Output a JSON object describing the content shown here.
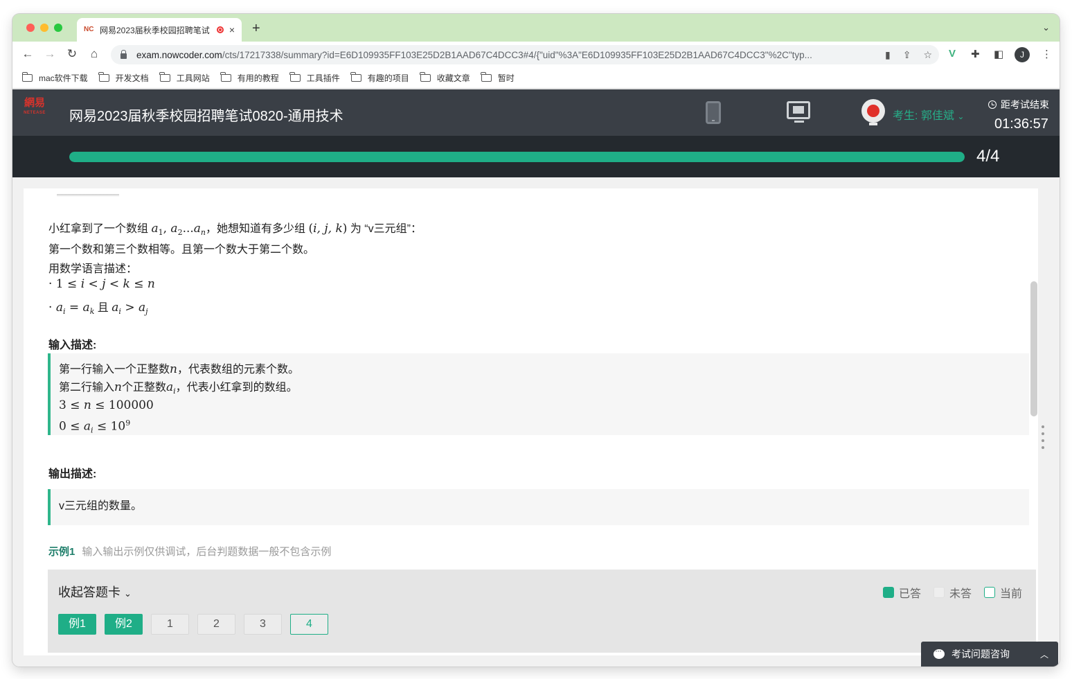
{
  "browser": {
    "tab_title": "网易2023届秋季校园招聘笔试",
    "tab_close": "×",
    "new_tab": "+",
    "tab_menu": "⌄",
    "url_host": "exam.nowcoder.com",
    "url_path": "/cts/17217338/summary?id=E6D109935FF103E25D2B1AAD67C4DCC3#4/{\"uid\"%3A\"E6D109935FF103E25D2B1AAD67C4DCC3\"%2C\"typ...",
    "avatar_letter": "J",
    "bookmarks": [
      "mac软件下载",
      "开发文档",
      "工具网站",
      "有用的教程",
      "工具插件",
      "有趣的项目",
      "收藏文章",
      "暂时"
    ]
  },
  "exam": {
    "logo_text": "網易",
    "logo_sub": "NETEASE",
    "title": "网易2023届秋季校园招聘笔试0820-通用技术",
    "candidate": "考生: 郭佳斌",
    "timer_label": "距考试结束",
    "timer_value": "01:36:57",
    "progress_text": "4/4",
    "progress_fraction": 1.0
  },
  "question": {
    "line1_a": "小红拿到了一个数组",
    "line1_math1": "a",
    "line1_b": "，她想知道有多少组",
    "line1_c": "为 “v三元组”：",
    "line2": "第一个数和第三个数相等。且第一个数大于第二个数。",
    "line3": "用数学语言描述：",
    "input_heading": "输入描述:",
    "input_lines_1a": "第一行输入一个正整数",
    "input_lines_1b": "，代表数组的元素个数。",
    "input_lines_2a": "第二行输入",
    "input_lines_2b": "个正整数",
    "input_lines_2c": "，代表小红拿到的数组。",
    "output_heading": "输出描述:",
    "output_text": "v三元组的数量。",
    "sample_label": "示例1",
    "sample_desc": "输入输出示例仅供调试，后台判题数据一般不包含示例"
  },
  "answer_card": {
    "collapse_label": "收起答题卡",
    "legend_done": "已答",
    "legend_todo": "未答",
    "legend_current": "当前",
    "buttons": [
      "例1",
      "例2",
      "1",
      "2",
      "3",
      "4"
    ]
  },
  "consult": {
    "label": "考试问题咨询"
  },
  "colors": {
    "accent": "#1fae87",
    "header_bg": "#3a3f46",
    "tab_strip": "#cde8c1"
  }
}
